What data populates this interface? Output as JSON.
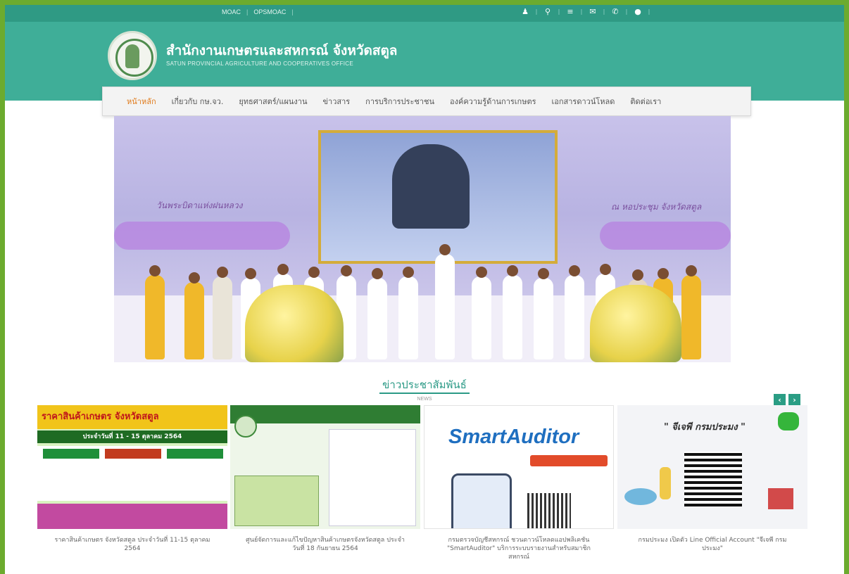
{
  "topbar": {
    "links": [
      "MOAC",
      "OPSMOAC"
    ],
    "icons": [
      "user-icon",
      "search-icon",
      "rss-icon",
      "mail-icon",
      "phone-icon",
      "map-pin-icon"
    ]
  },
  "brand": {
    "title": "สำนักงานเกษตรและสหกรณ์ จังหวัดสตูล",
    "subtitle": "SATUN PROVINCIAL AGRICULTURE AND COOPERATIVES OFFICE",
    "header_color": "#3fae98",
    "accent_color": "#e07a1a"
  },
  "nav": {
    "items": [
      "หน้าหลัก",
      "เกี่ยวกับ กษ.จว.",
      "ยุทธศาสตร์/แผนงาน",
      "ข่าวสาร",
      "การบริการประชาชน",
      "องค์ความรู้ด้านการเกษตร",
      "เอกสารดาวน์โหลด",
      "ติดต่อเรา"
    ],
    "active_index": 0
  },
  "banner": {
    "left_text": "วันพระบิดาแห่งฝนหลวง",
    "right_text": "ณ หอประชุม จังหวัดสตูล"
  },
  "news": {
    "title": "ข่าวประชาสัมพันธ์",
    "subtitle": "NEWS",
    "prev_label": "‹",
    "next_label": "›",
    "cards": [
      {
        "thumb_heading": "ราคาสินค้าเกษตร จังหวัดสตูล",
        "thumb_date": "ประจำวันที่ 11 - 15 ตุลาคม 2564",
        "caption": "ราคาสินค้าเกษตร จังหวัดสตูล ประจำวันที่ 11-15 ตุลาคม 2564"
      },
      {
        "caption": "ศูนย์จัดการและแก้ไขปัญหาสินค้าเกษตรจังหวัดสตูล ประจำวันที่ 18 กันยายน 2564"
      },
      {
        "thumb_brand": "SmartAuditor",
        "caption": "กรมตรวจบัญชีสหกรณ์ ชวนดาวน์โหลดแอปพลิเคชัน \"SmartAuditor\" บริการระบบรายงานสำหรับสมาชิกสหกรณ์"
      },
      {
        "thumb_quote": "\" จีเจพี กรมประมง \"",
        "caption": "กรมประมง เปิดตัว Line Official Account \"จีเจพี กรมประมง\""
      }
    ]
  }
}
